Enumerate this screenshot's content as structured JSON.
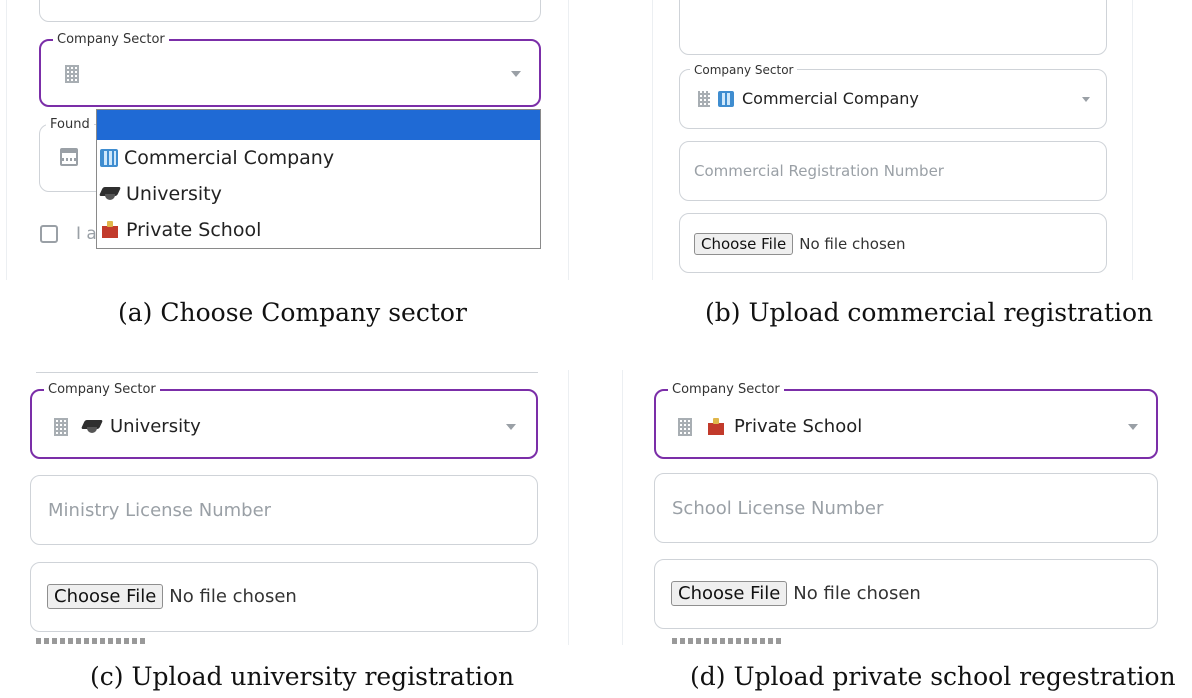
{
  "panels": {
    "a": {
      "sector_legend": "Company Sector",
      "founding_legend_partial": "Found",
      "checkbox_partial": "I a",
      "dropdown_options": [
        "Commercial Company",
        "University",
        "Private School"
      ],
      "caption": "(a) Choose Company sector"
    },
    "b": {
      "sector_legend": "Company Sector",
      "sector_value": "Commercial Company",
      "registration_placeholder": "Commercial Registration Number",
      "file_button": "Choose File",
      "file_status": "No file chosen",
      "caption": "(b) Upload commercial registration"
    },
    "c": {
      "sector_legend": "Company Sector",
      "sector_value": "University",
      "license_placeholder": "Ministry License Number",
      "file_button": "Choose File",
      "file_status": "No file chosen",
      "caption": "(c) Upload university registration"
    },
    "d": {
      "sector_legend": "Company Sector",
      "sector_value": "Private School",
      "license_placeholder": "School License Number",
      "file_button": "Choose File",
      "file_status": "No file chosen",
      "caption": "(d) Upload private school regestration"
    }
  },
  "colors": {
    "focus_border": "#7b2ea8",
    "dropdown_highlight": "#1f6ad5",
    "placeholder": "#9aa0a6"
  },
  "icons": {
    "sector_field": "building-icon",
    "founding_field": "calendar-icon",
    "commercial": "office-building-emoji",
    "university": "graduation-cap-emoji",
    "school": "school-emoji",
    "dropdown": "chevron-down-icon"
  }
}
